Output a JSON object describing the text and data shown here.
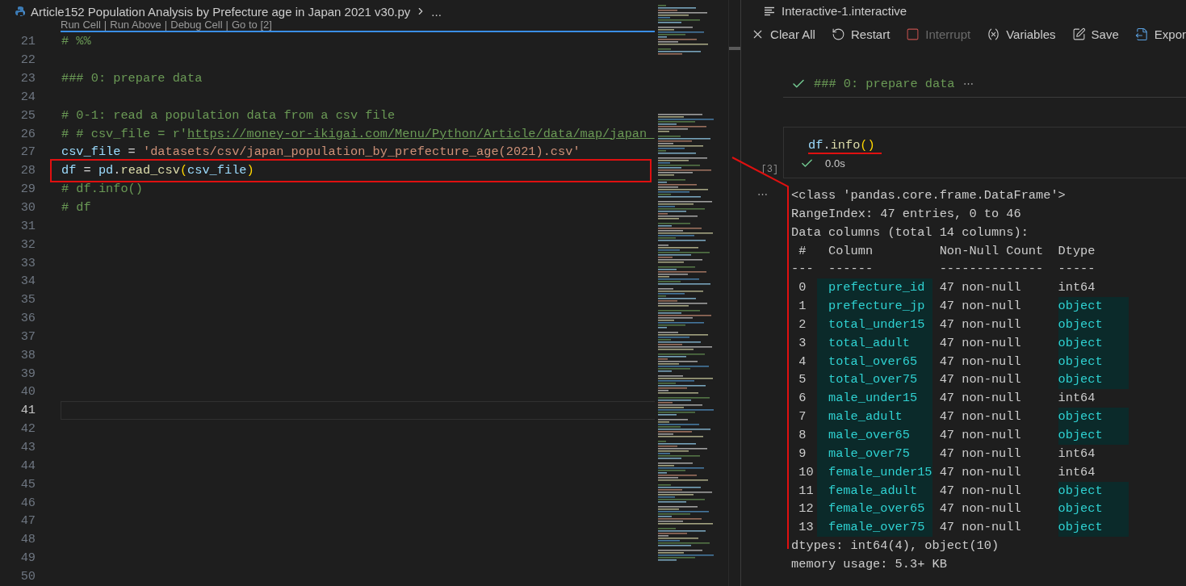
{
  "editor": {
    "breadcrumb": {
      "file": "Article152 Population Analysis by Prefecture age in Japan 2021 v30.py",
      "more": "..."
    },
    "codelens": {
      "links": [
        "Run Cell",
        "Run Above",
        "Debug Cell",
        "Go to [2]"
      ],
      "separator": "|"
    },
    "lines": [
      {
        "number": "21",
        "tokens": [
          {
            "text": "# %%",
            "kind": "comment"
          }
        ]
      },
      {
        "number": "22"
      },
      {
        "number": "23",
        "tokens": [
          {
            "text": "### 0: prepare data",
            "kind": "comment"
          }
        ]
      },
      {
        "number": "24"
      },
      {
        "number": "25",
        "tokens": [
          {
            "text": "# 0-1: read a population data from a csv file",
            "kind": "comment"
          }
        ]
      },
      {
        "number": "26",
        "tokens": [
          {
            "text": "# # csv_file = r'",
            "kind": "comment"
          },
          {
            "text": "https://money-or-ikigai.com/Menu/Python/Article/data/map/japan_",
            "kind": "link"
          }
        ]
      },
      {
        "number": "27",
        "tokens": [
          {
            "text": "csv_file",
            "kind": "variable"
          },
          {
            "text": " = ",
            "kind": "plain"
          },
          {
            "text": "'datasets/csv/japan_population_by_prefecture_age(2021).csv'",
            "kind": "string"
          }
        ]
      },
      {
        "number": "28",
        "highlighted": true,
        "tokens": [
          {
            "text": "df",
            "kind": "variable"
          },
          {
            "text": " = ",
            "kind": "plain"
          },
          {
            "text": "pd",
            "kind": "variable"
          },
          {
            "text": ".",
            "kind": "plain"
          },
          {
            "text": "read_csv",
            "kind": "function"
          },
          {
            "text": "(",
            "kind": "paren"
          },
          {
            "text": "csv_file",
            "kind": "variable"
          },
          {
            "text": ")",
            "kind": "paren"
          }
        ]
      },
      {
        "number": "29",
        "tokens": [
          {
            "text": "# df.info()",
            "kind": "comment"
          }
        ]
      },
      {
        "number": "30",
        "tokens": [
          {
            "text": "# df",
            "kind": "comment"
          }
        ]
      },
      {
        "number": "31"
      },
      {
        "number": "32"
      },
      {
        "number": "33"
      },
      {
        "number": "34"
      },
      {
        "number": "35"
      },
      {
        "number": "36"
      },
      {
        "number": "37"
      },
      {
        "number": "38"
      },
      {
        "number": "39"
      },
      {
        "number": "40"
      },
      {
        "number": "41",
        "current": true
      },
      {
        "number": "42"
      },
      {
        "number": "43"
      },
      {
        "number": "44"
      },
      {
        "number": "45"
      },
      {
        "number": "46"
      },
      {
        "number": "47"
      },
      {
        "number": "48"
      },
      {
        "number": "49"
      },
      {
        "number": "50"
      }
    ]
  },
  "interactive": {
    "title": "Interactive-1.interactive",
    "toolbar": [
      {
        "label": "Clear All",
        "kind": "close",
        "disabled": false
      },
      {
        "label": "Restart",
        "kind": "restart",
        "disabled": false
      },
      {
        "label": "Interrupt",
        "kind": "stop",
        "disabled": true
      },
      {
        "label": "Variables",
        "kind": "variables",
        "disabled": false
      },
      {
        "label": "Save",
        "kind": "save",
        "disabled": false
      },
      {
        "label": "Expor",
        "kind": "export",
        "disabled": false
      }
    ],
    "markdown_cell": {
      "text": "### 0: prepare data",
      "more": "⋯"
    },
    "code_cell": {
      "code": [
        {
          "text": "df",
          "kind": "variable"
        },
        {
          "text": ".",
          "kind": "plain"
        },
        {
          "text": "info",
          "kind": "function"
        },
        {
          "text": "()",
          "kind": "paren"
        }
      ],
      "underlined": true,
      "count": "[3]",
      "duration": "0.0s"
    },
    "output": {
      "more": "⋯",
      "header_lines": [
        "<class 'pandas.core.frame.DataFrame'>",
        "RangeIndex: 47 entries, 0 to 46",
        "Data columns (total 14 columns):"
      ],
      "columns": [
        "#",
        "Column",
        "Non-Null Count",
        "Dtype"
      ],
      "rules": [
        "---",
        "------",
        "--------------",
        "-----"
      ],
      "rows": [
        {
          "index": "0",
          "column": "prefecture_id",
          "count": "47 non-null",
          "dtype": "int64",
          "highlighted": false
        },
        {
          "index": "1",
          "column": "prefecture_jp",
          "count": "47 non-null",
          "dtype": "object",
          "highlighted": true
        },
        {
          "index": "2",
          "column": "total_under15",
          "count": "47 non-null",
          "dtype": "object",
          "highlighted": true
        },
        {
          "index": "3",
          "column": "total_adult",
          "count": "47 non-null",
          "dtype": "object",
          "highlighted": true
        },
        {
          "index": "4",
          "column": "total_over65",
          "count": "47 non-null",
          "dtype": "object",
          "highlighted": true
        },
        {
          "index": "5",
          "column": "total_over75",
          "count": "47 non-null",
          "dtype": "object",
          "highlighted": true
        },
        {
          "index": "6",
          "column": "male_under15",
          "count": "47 non-null",
          "dtype": "int64",
          "highlighted": false
        },
        {
          "index": "7",
          "column": "male_adult",
          "count": "47 non-null",
          "dtype": "object",
          "highlighted": true
        },
        {
          "index": "8",
          "column": "male_over65",
          "count": "47 non-null",
          "dtype": "object",
          "highlighted": true
        },
        {
          "index": "9",
          "column": "male_over75",
          "count": "47 non-null",
          "dtype": "int64",
          "highlighted": false
        },
        {
          "index": "10",
          "column": "female_under15",
          "count": "47 non-null",
          "dtype": "int64",
          "highlighted": false
        },
        {
          "index": "11",
          "column": "female_adult",
          "count": "47 non-null",
          "dtype": "object",
          "highlighted": true
        },
        {
          "index": "12",
          "column": "female_over65",
          "count": "47 non-null",
          "dtype": "object",
          "highlighted": true
        },
        {
          "index": "13",
          "column": "female_over75",
          "count": "47 non-null",
          "dtype": "object",
          "highlighted": true
        }
      ],
      "footer_lines": [
        "dtypes: int64(4), object(10)",
        "memory usage: 5.3+ KB"
      ]
    }
  }
}
